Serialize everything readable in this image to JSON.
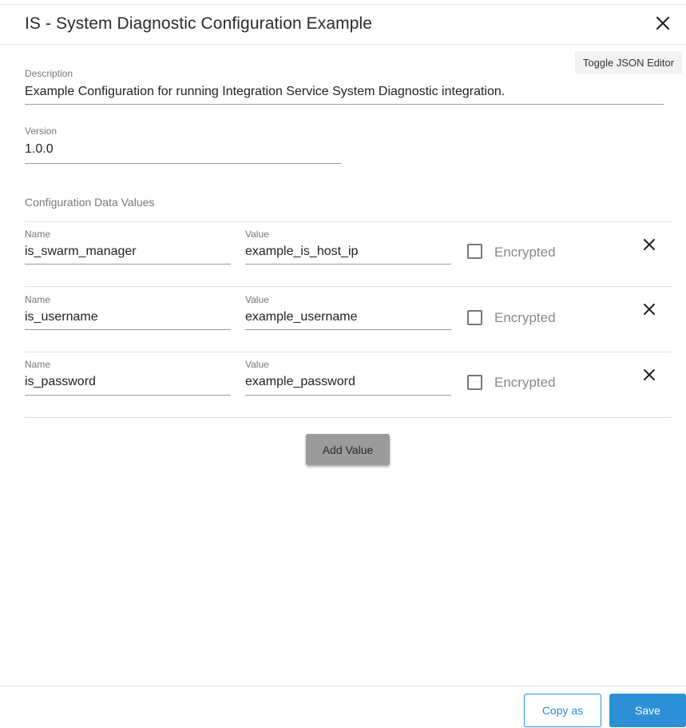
{
  "dialog": {
    "title": "IS - System Diagnostic Configuration Example",
    "close_icon": "close-icon"
  },
  "toggle_json_editor_label": "Toggle JSON Editor",
  "description": {
    "label": "Description",
    "value": "Example Configuration for running Integration Service System Diagnostic integration."
  },
  "version": {
    "label": "Version",
    "value": "1.0.0"
  },
  "config_values": {
    "section_label": "Configuration Data Values",
    "rows": [
      {
        "name_label": "Name",
        "name": "is_swarm_manager",
        "value_label": "Value",
        "value": "example_is_host_ip",
        "encrypted_label": "Encrypted",
        "encrypted": false
      },
      {
        "name_label": "Name",
        "name": "is_username",
        "value_label": "Value",
        "value": "example_username",
        "encrypted_label": "Encrypted",
        "encrypted": false
      },
      {
        "name_label": "Name",
        "name": "is_password",
        "value_label": "Value",
        "value": "example_password",
        "encrypted_label": "Encrypted",
        "encrypted": false
      }
    ],
    "add_value_label": "Add Value"
  },
  "footer": {
    "copy_as_label": "Copy as",
    "save_label": "Save"
  },
  "colors": {
    "primary": "#2d8fd6",
    "add_button_bg": "#9b9b9b"
  }
}
